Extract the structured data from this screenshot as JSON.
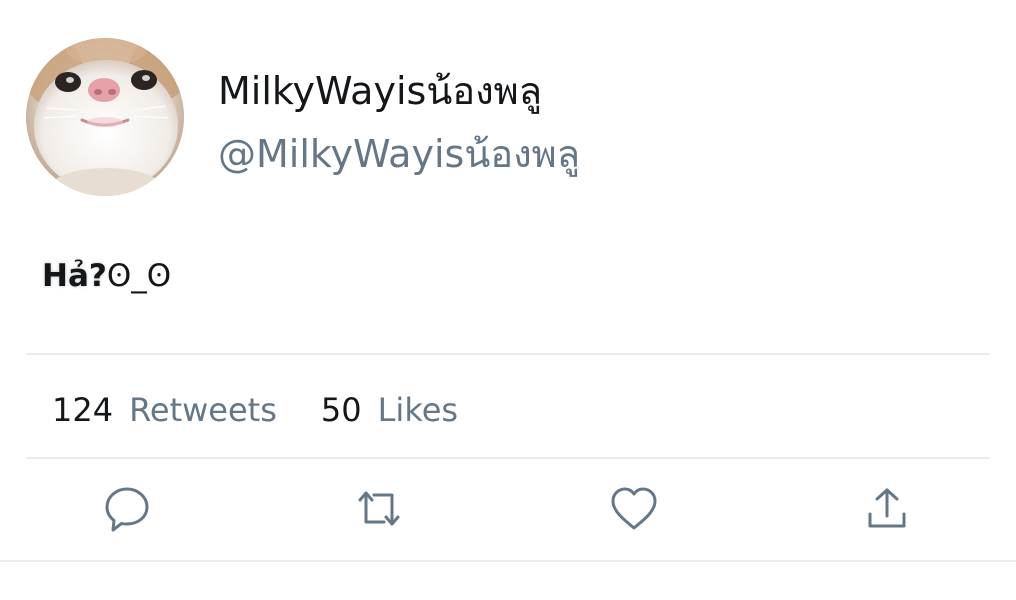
{
  "tweet": {
    "author": {
      "display_name": "MilkyWayisน้องพลู",
      "handle": "@MilkyWayisน้องพลู"
    },
    "text_bold": "Hả?",
    "text_rest": "ʘ_ʘ",
    "stats": {
      "retweets_count": "124",
      "retweets_label": "Retweets",
      "likes_count": "50",
      "likes_label": "Likes"
    },
    "actions": {
      "reply_icon": "reply-icon",
      "retweet_icon": "retweet-icon",
      "like_icon": "heart-icon",
      "share_icon": "share-icon"
    }
  }
}
